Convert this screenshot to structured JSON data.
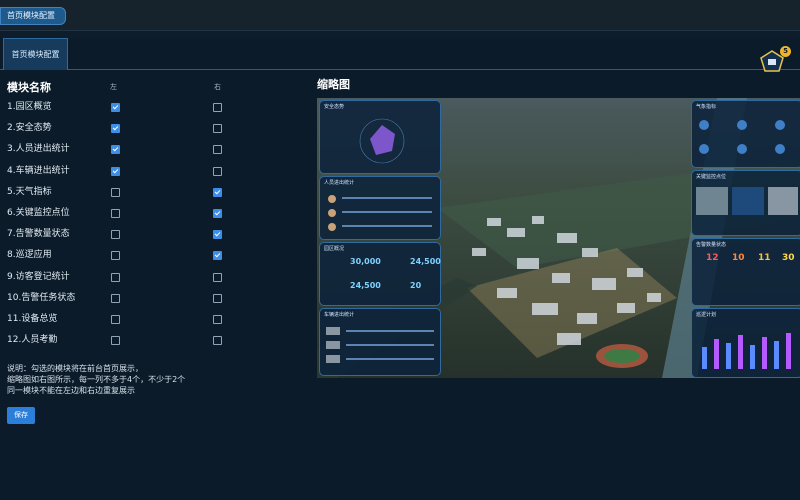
{
  "top_tab": {
    "label": "首页模块配置"
  },
  "panel_tab": {
    "label": "首页模块配置"
  },
  "notification": {
    "count": "5"
  },
  "module_list": {
    "heading": "模块名称",
    "col_left": "左",
    "col_right": "右",
    "items": [
      {
        "label": "1.园区概览",
        "left": true,
        "right": false
      },
      {
        "label": "2.安全态势",
        "left": true,
        "right": false
      },
      {
        "label": "3.人员进出统计",
        "left": true,
        "right": false
      },
      {
        "label": "4.车辆进出统计",
        "left": true,
        "right": false
      },
      {
        "label": "5.天气指标",
        "left": false,
        "right": true
      },
      {
        "label": "6.关键监控点位",
        "left": false,
        "right": true
      },
      {
        "label": "7.告警数量状态",
        "left": false,
        "right": true
      },
      {
        "label": "8.巡逻应用",
        "left": false,
        "right": true
      },
      {
        "label": "9.访客登记统计",
        "left": false,
        "right": false
      },
      {
        "label": "10.告警任务状态",
        "left": false,
        "right": false
      },
      {
        "label": "11.设备总览",
        "left": false,
        "right": false
      },
      {
        "label": "12.人员考勤",
        "left": false,
        "right": false
      }
    ]
  },
  "note": {
    "line1": "说明：勾选的模块将在前台首页展示，",
    "line2": "缩略图如右图所示，每一列不多于4个，不少于2个",
    "line3": "同一模块不能在左边和右边重复展示"
  },
  "save_label": "保存",
  "thumbnail": {
    "heading": "缩略图",
    "safety_title": "安全态势",
    "person_title": "人员进出统计",
    "park_title": "园区概况",
    "vehicle_title": "车辆进出统计",
    "weather_title": "气象指标",
    "monitor_title": "关键监控点位",
    "alarm_title": "告警数量状态",
    "patrol_title": "巡逻计划",
    "park_values": [
      "30,000",
      "24,500",
      "24,500",
      "20"
    ],
    "alarm_values": [
      "12",
      "10",
      "11",
      "30"
    ]
  },
  "colors": {
    "accent": "#2c7fd8",
    "checked": "#3d8ee8",
    "badge": "#f0b429"
  }
}
